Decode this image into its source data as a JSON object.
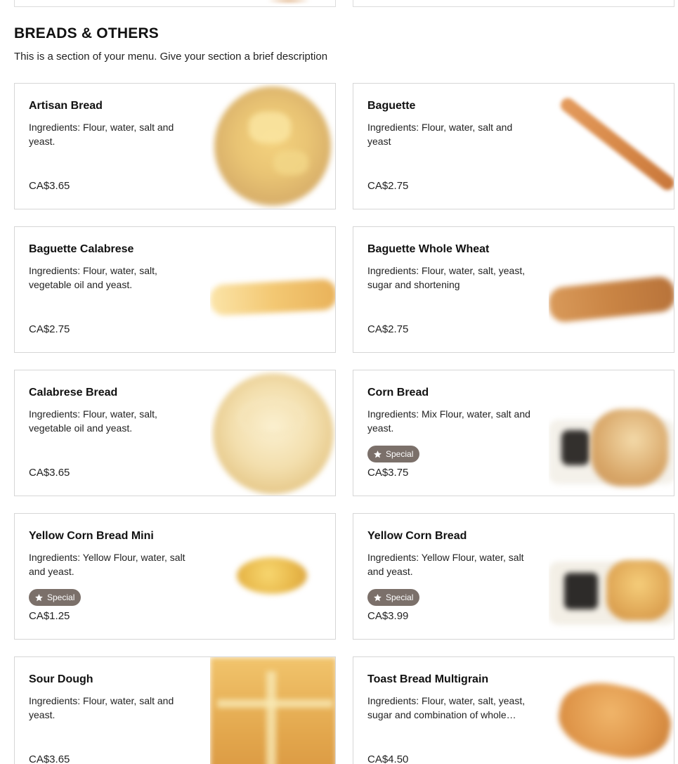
{
  "section": {
    "title": "BREADS & OTHERS",
    "description": "This is a section of your menu. Give your section a brief description"
  },
  "items": [
    {
      "name": "Artisan Bread",
      "description": "Ingredients: Flour, water, salt and yeast.",
      "price": "CA$3.65",
      "badge": "",
      "image_icon": "artisan-bread-image"
    },
    {
      "name": "Baguette",
      "description": "Ingredients: Flour, water, salt and yeast",
      "price": "CA$2.75",
      "badge": "",
      "image_icon": "baguette-image"
    },
    {
      "name": "Baguette Calabrese",
      "description": "Ingredients: Flour, water, salt, vegetable oil and yeast.",
      "price": "CA$2.75",
      "badge": "",
      "image_icon": "baguette-calabrese-image"
    },
    {
      "name": "Baguette Whole Wheat",
      "description": "Ingredients: Flour, water, salt, yeast, sugar and shortening",
      "price": "CA$2.75",
      "badge": "",
      "image_icon": "baguette-whole-wheat-image"
    },
    {
      "name": "Calabrese Bread",
      "description": "Ingredients: Flour, water, salt, vegetable oil and yeast.",
      "price": "CA$3.65",
      "badge": "",
      "image_icon": "calabrese-bread-image"
    },
    {
      "name": "Corn Bread",
      "description": "Ingredients: Mix Flour, water, salt and yeast.",
      "price": "CA$3.75",
      "badge": "Special",
      "image_icon": "corn-bread-image"
    },
    {
      "name": "Yellow Corn Bread Mini",
      "description": "Ingredients: Yellow Flour, water, salt and yeast.",
      "price": "CA$1.25",
      "badge": "Special",
      "image_icon": "yellow-corn-bread-mini-image"
    },
    {
      "name": "Yellow Corn Bread",
      "description": "Ingredients: Yellow Flour, water, salt and yeast.",
      "price": "CA$3.99",
      "badge": "Special",
      "image_icon": "yellow-corn-bread-image"
    },
    {
      "name": "Sour Dough",
      "description": "Ingredients: Flour, water, salt and yeast.",
      "price": "CA$3.65",
      "badge": "",
      "image_icon": "sour-dough-image"
    },
    {
      "name": "Toast Bread Multigrain",
      "description": "Ingredients: Flour, water, salt, yeast, sugar and combination of whole…",
      "price": "CA$4.50",
      "badge": "",
      "image_icon": "toast-bread-multigrain-image"
    }
  ],
  "colors": {
    "badge_bg": "#7b706a",
    "card_border": "#d6d6d6",
    "text": "#111111"
  }
}
